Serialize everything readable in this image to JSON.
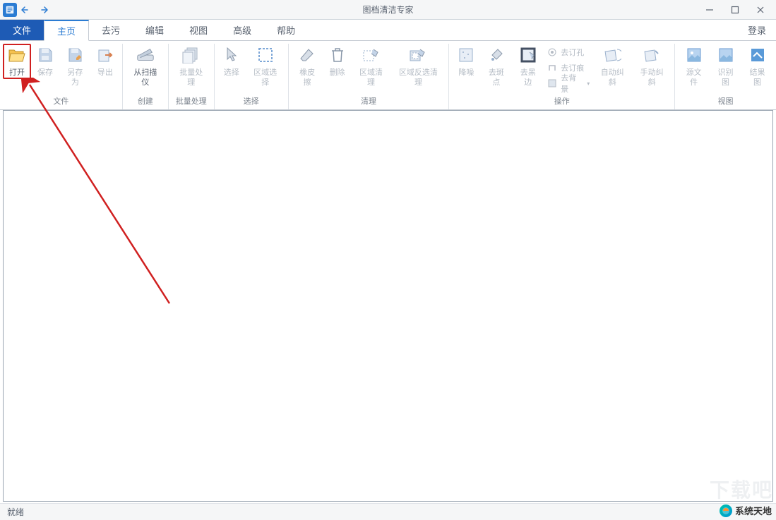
{
  "app": {
    "title": "图档清洁专家"
  },
  "tabs": {
    "file": "文件",
    "home": "主页",
    "decontaminate": "去污",
    "edit": "编辑",
    "view": "视图",
    "advanced": "高级",
    "help": "帮助",
    "login": "登录"
  },
  "ribbon": {
    "groups": {
      "file": {
        "label": "文件",
        "open": "打开",
        "save": "保存",
        "saveAs": "另存为",
        "export": "导出"
      },
      "create": {
        "label": "创建",
        "fromScanner": "从扫描仪"
      },
      "batch": {
        "label": "批量处理",
        "batchProcess": "批量处理"
      },
      "select": {
        "label": "选择",
        "select": "选择",
        "areaSelect": "区域选择"
      },
      "clean": {
        "label": "清理",
        "eraser": "橡皮擦",
        "delete": "删除",
        "areaClean": "区域清理",
        "areaInverseClean": "区域反选清理"
      },
      "operate": {
        "label": "操作",
        "denoise": "降噪",
        "removeSpots": "去斑点",
        "removeBlackEdge": "去黑边",
        "removeHoles": "去订孔",
        "removeStaples": "去订痕",
        "removeBackground": "去背景",
        "autoDeskew": "自动纠斜",
        "manualDeskew": "手动纠斜"
      },
      "viewGroup": {
        "label": "视图",
        "sourceFile": "源文件",
        "recognize": "识别图",
        "result": "结果图"
      }
    }
  },
  "status": {
    "ready": "就绪"
  },
  "watermark": {
    "text": "系统天地"
  }
}
